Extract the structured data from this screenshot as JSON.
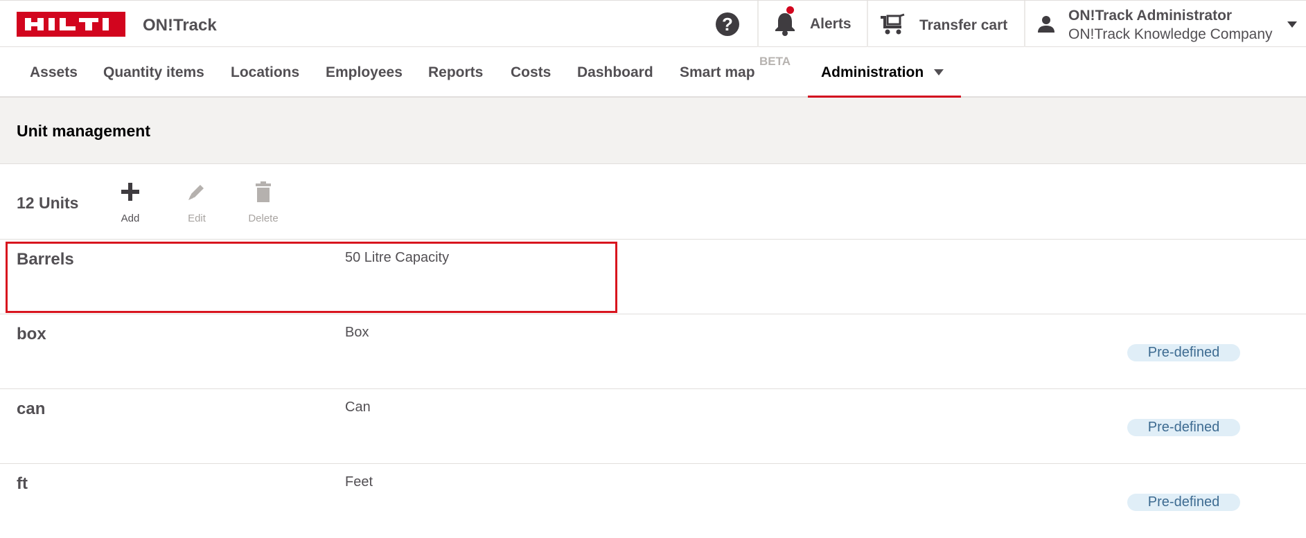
{
  "header": {
    "brand": "HILTI",
    "app_name": "ON!Track",
    "help_glyph": "?",
    "alerts_label": "Alerts",
    "cart_label": "Transfer cart",
    "user_name": "ON!Track Administrator",
    "user_company": "ON!Track Knowledge Company",
    "brand_color": "#d2051e"
  },
  "nav": {
    "items": [
      {
        "label": "Assets"
      },
      {
        "label": "Quantity items"
      },
      {
        "label": "Locations"
      },
      {
        "label": "Employees"
      },
      {
        "label": "Reports"
      },
      {
        "label": "Costs"
      },
      {
        "label": "Dashboard"
      },
      {
        "label": "Smart map",
        "badge": "BETA"
      },
      {
        "label": "Administration",
        "active": true
      }
    ]
  },
  "section": {
    "title": "Unit management"
  },
  "toolbar": {
    "count_label": "12 Units",
    "add_label": "Add",
    "edit_label": "Edit",
    "delete_label": "Delete"
  },
  "units": [
    {
      "name": "Barrels",
      "description": "50 Litre Capacity",
      "badge": ""
    },
    {
      "name": "box",
      "description": "Box",
      "badge": "Pre-defined"
    },
    {
      "name": "can",
      "description": "Can",
      "badge": "Pre-defined"
    },
    {
      "name": "ft",
      "description": "Feet",
      "badge": "Pre-defined"
    }
  ]
}
